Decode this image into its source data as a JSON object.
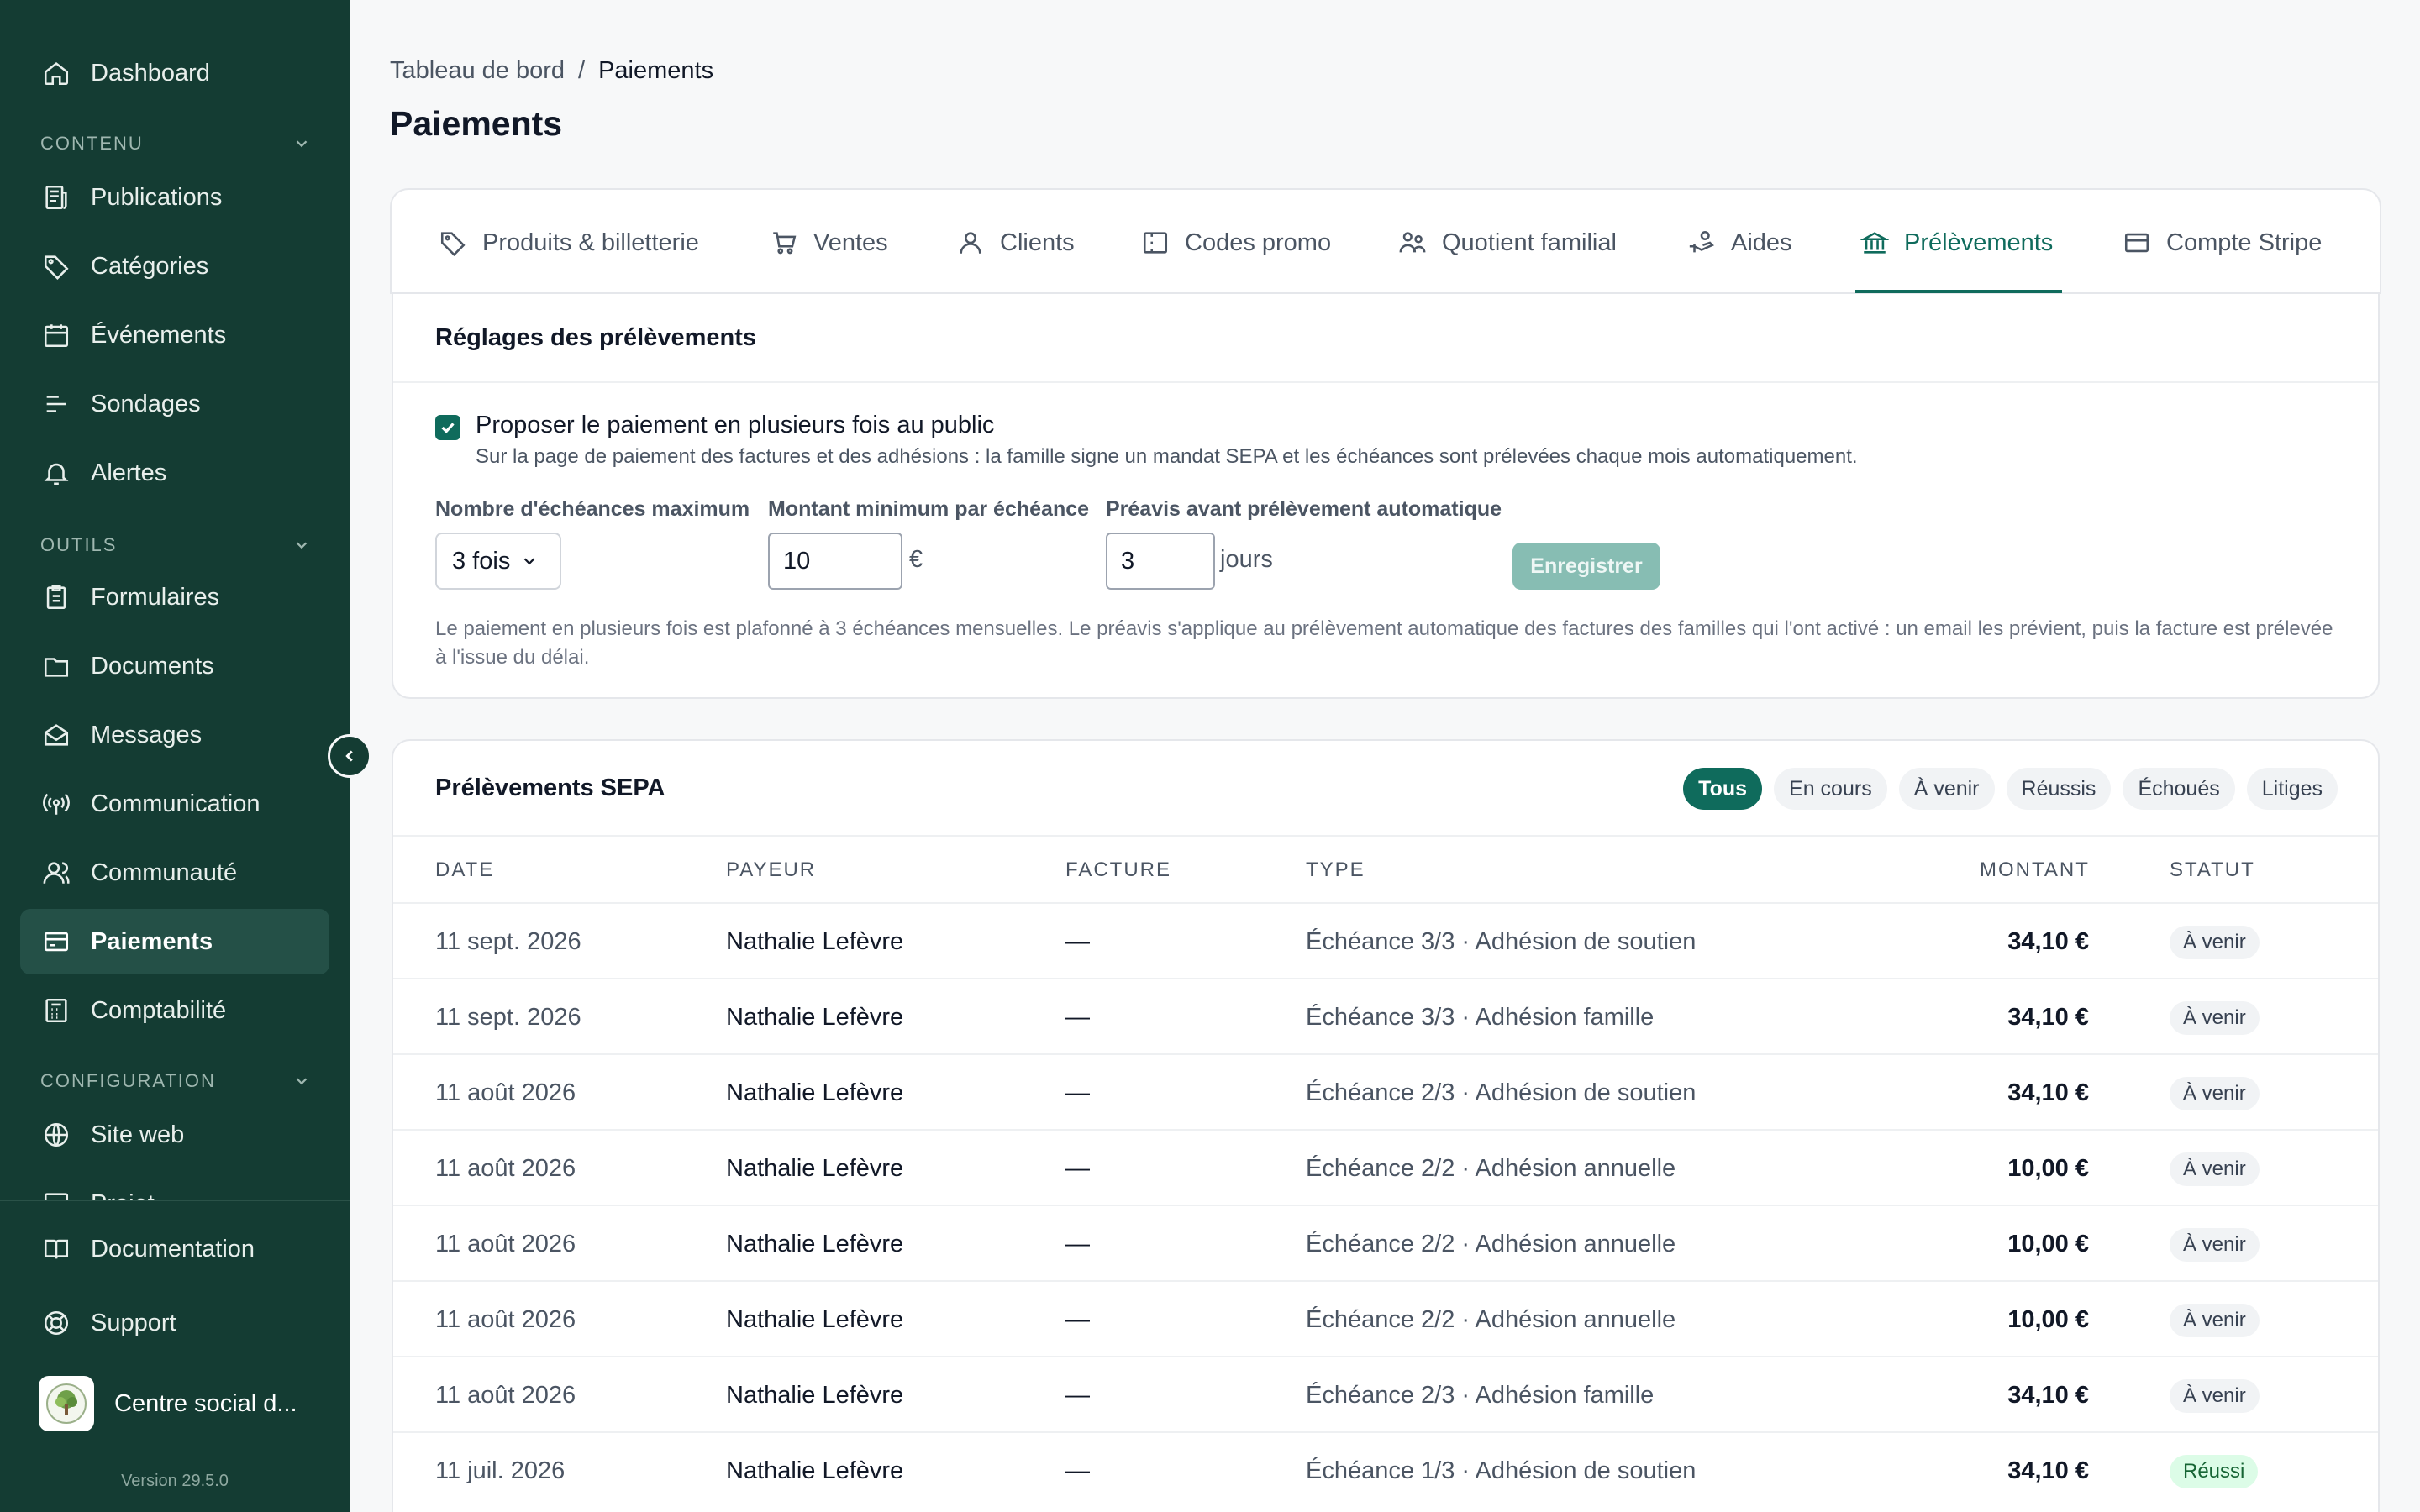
{
  "sidebar": {
    "items": [
      {
        "label": "Dashboard",
        "icon": "home-icon"
      },
      {
        "label": "Publications",
        "icon": "newspaper-icon"
      },
      {
        "label": "Catégories",
        "icon": "tag-icon"
      },
      {
        "label": "Événements",
        "icon": "calendar-icon"
      },
      {
        "label": "Sondages",
        "icon": "list-icon"
      },
      {
        "label": "Alertes",
        "icon": "bell-icon"
      },
      {
        "label": "Formulaires",
        "icon": "clipboard-icon"
      },
      {
        "label": "Documents",
        "icon": "folder-icon"
      },
      {
        "label": "Messages",
        "icon": "mail-icon"
      },
      {
        "label": "Communication",
        "icon": "broadcast-icon"
      },
      {
        "label": "Communauté",
        "icon": "users-icon"
      },
      {
        "label": "Paiements",
        "icon": "credit-card-icon"
      },
      {
        "label": "Comptabilité",
        "icon": "calculator-icon"
      },
      {
        "label": "Site web",
        "icon": "globe-icon"
      },
      {
        "label": "Projet",
        "icon": "project-icon"
      }
    ],
    "sections": {
      "content": "CONTENU",
      "tools": "OUTILS",
      "config": "CONFIGURATION"
    },
    "footer": {
      "documentation": "Documentation",
      "support": "Support"
    },
    "org_name": "Centre social d...",
    "version": "Version 29.5.0"
  },
  "header": {
    "breadcrumb_root": "Tableau de bord",
    "breadcrumb_sep": "/",
    "breadcrumb_current": "Paiements",
    "title": "Paiements"
  },
  "tabs": [
    {
      "label": "Produits & billetterie",
      "icon": "tag-icon"
    },
    {
      "label": "Ventes",
      "icon": "cart-icon"
    },
    {
      "label": "Clients",
      "icon": "user-icon"
    },
    {
      "label": "Codes promo",
      "icon": "ticket-icon"
    },
    {
      "label": "Quotient familial",
      "icon": "family-icon"
    },
    {
      "label": "Aides",
      "icon": "hand-coins-icon"
    },
    {
      "label": "Prélèvements",
      "icon": "bank-icon"
    },
    {
      "label": "Compte Stripe",
      "icon": "card-icon"
    }
  ],
  "settings": {
    "title": "Réglages des prélèvements",
    "checkbox_label": "Proposer le paiement en plusieurs fois au public",
    "checkbox_help": "Sur la page de paiement des factures et des adhésions : la famille signe un mandat SEPA et les échéances sont prélevées chaque mois automatiquement.",
    "max_installments_label": "Nombre d'échéances maximum",
    "max_installments_value": "3 fois",
    "min_amount_label": "Montant minimum par échéance",
    "min_amount_value": "10",
    "min_amount_unit": "€",
    "notice_label": "Préavis avant prélèvement automatique",
    "notice_value": "3",
    "notice_unit": "jours",
    "save_label": "Enregistrer",
    "note": "Le paiement en plusieurs fois est plafonné à 3 échéances mensuelles. Le préavis s'applique au prélèvement automatique des factures des familles qui l'ont activé : un email les prévient, puis la facture est prélevée à l'issue du délai."
  },
  "sepa": {
    "title": "Prélèvements SEPA",
    "filters": [
      "Tous",
      "En cours",
      "À venir",
      "Réussis",
      "Échoués",
      "Litiges"
    ],
    "columns": {
      "date": "DATE",
      "payer": "PAYEUR",
      "invoice": "FACTURE",
      "type": "TYPE",
      "amount": "MONTANT",
      "status": "STATUT"
    },
    "rows": [
      {
        "date": "11 sept. 2026",
        "payer": "Nathalie Lefèvre",
        "invoice": "—",
        "type": "Échéance 3/3 · Adhésion de soutien",
        "amount": "34,10 €",
        "status": "À venir"
      },
      {
        "date": "11 sept. 2026",
        "payer": "Nathalie Lefèvre",
        "invoice": "—",
        "type": "Échéance 3/3 · Adhésion famille",
        "amount": "34,10 €",
        "status": "À venir"
      },
      {
        "date": "11 août 2026",
        "payer": "Nathalie Lefèvre",
        "invoice": "—",
        "type": "Échéance 2/3 · Adhésion de soutien",
        "amount": "34,10 €",
        "status": "À venir"
      },
      {
        "date": "11 août 2026",
        "payer": "Nathalie Lefèvre",
        "invoice": "—",
        "type": "Échéance 2/2 · Adhésion annuelle",
        "amount": "10,00 €",
        "status": "À venir"
      },
      {
        "date": "11 août 2026",
        "payer": "Nathalie Lefèvre",
        "invoice": "—",
        "type": "Échéance 2/2 · Adhésion annuelle",
        "amount": "10,00 €",
        "status": "À venir"
      },
      {
        "date": "11 août 2026",
        "payer": "Nathalie Lefèvre",
        "invoice": "—",
        "type": "Échéance 2/2 · Adhésion annuelle",
        "amount": "10,00 €",
        "status": "À venir"
      },
      {
        "date": "11 août 2026",
        "payer": "Nathalie Lefèvre",
        "invoice": "—",
        "type": "Échéance 2/3 · Adhésion famille",
        "amount": "34,10 €",
        "status": "À venir"
      },
      {
        "date": "11 juil. 2026",
        "payer": "Nathalie Lefèvre",
        "invoice": "—",
        "type": "Échéance 1/3 · Adhésion de soutien",
        "amount": "34,10 €",
        "status": "Réussi"
      }
    ]
  },
  "colors": {
    "sidebar": "#143c33",
    "accent": "#0f6b5c",
    "success": "#166534"
  }
}
